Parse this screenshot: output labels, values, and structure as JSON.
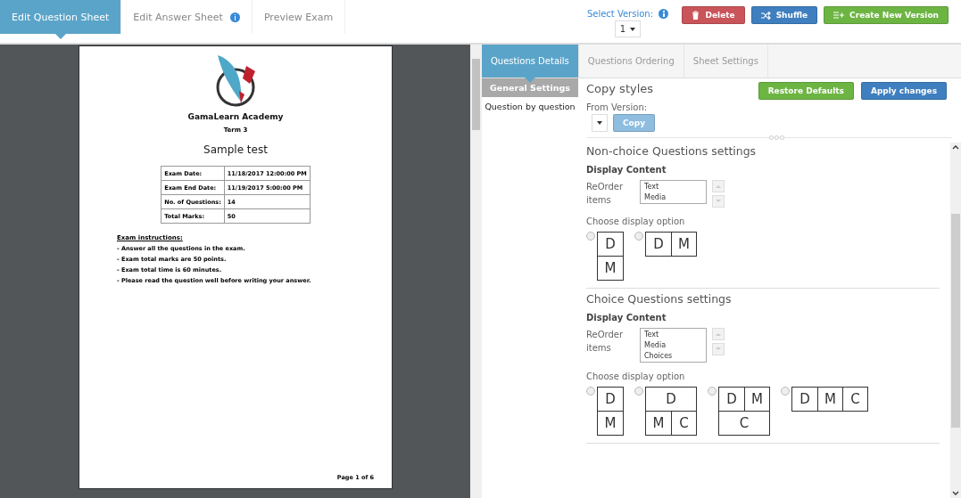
{
  "top_tabs": [
    {
      "label": "Edit Question Sheet",
      "selected": true,
      "info": false
    },
    {
      "label": "Edit Answer Sheet",
      "selected": false,
      "info": true
    },
    {
      "label": "Preview Exam",
      "selected": false,
      "info": false
    }
  ],
  "version": {
    "label": "Select Version:",
    "value": "1"
  },
  "actions": [
    {
      "kind": "delete",
      "label": "Delete"
    },
    {
      "kind": "shuffle",
      "label": "Shuffle"
    },
    {
      "kind": "create",
      "label": "Create New Version"
    }
  ],
  "preview": {
    "academy": "GamaLearn Academy",
    "term": "Term 3",
    "title": "Sample test",
    "info_rows": [
      {
        "label": "Exam Date:",
        "value": "11/18/2017 12:00:00 PM"
      },
      {
        "label": "Exam End Date:",
        "value": "11/19/2017 5:00:00 PM"
      },
      {
        "label": "No. of Questions:",
        "value": "14"
      },
      {
        "label": "Total Marks:",
        "value": "50"
      }
    ],
    "instructions_title": "Exam instructions:",
    "instructions": [
      "- Answer all the questions in the exam.",
      "- Exam total marks are 50 points.",
      "- Exam total time is 60 minutes.",
      "- Please read the question well before writing your answer."
    ],
    "page": "Page 1 of 6"
  },
  "settings_tabs": [
    {
      "label": "Questions Details",
      "selected": true
    },
    {
      "label": "Questions Ordering",
      "selected": false
    },
    {
      "label": "Sheet Settings",
      "selected": false
    }
  ],
  "side_items": [
    {
      "label": "General Settings",
      "selected": true
    },
    {
      "label": "Question by question",
      "selected": false
    }
  ],
  "copy": {
    "title": "Copy styles",
    "from_label": "From Version:",
    "button": "Copy",
    "restore": "Restore Defaults",
    "apply": "Apply changes"
  },
  "sections": [
    {
      "title": "Non-choice Questions settings",
      "content_title": "Display Content",
      "reorder_label": "ReOrder items",
      "items": [
        "Text",
        "Media"
      ],
      "option_label": "Choose display option",
      "options": [
        {
          "selected": false,
          "rows": [
            [
              "D"
            ],
            [
              "M"
            ]
          ]
        },
        {
          "selected": false,
          "rows": [
            [
              "D",
              "M"
            ]
          ]
        }
      ]
    },
    {
      "title": "Choice Questions settings",
      "content_title": "Display Content",
      "reorder_label": "ReOrder items",
      "items": [
        "Text",
        "Media",
        "Choices"
      ],
      "option_label": "Choose display option",
      "options": [
        {
          "selected": false,
          "rows": [
            [
              "D"
            ],
            [
              "M"
            ]
          ]
        },
        {
          "selected": false,
          "rows": [
            [
              "D"
            ],
            [
              "M",
              "C"
            ]
          ]
        },
        {
          "selected": false,
          "rows": [
            [
              "D",
              "M"
            ],
            [
              "C"
            ]
          ]
        },
        {
          "selected": false,
          "rows": [
            [
              "D",
              "M",
              "C"
            ]
          ]
        }
      ]
    }
  ]
}
